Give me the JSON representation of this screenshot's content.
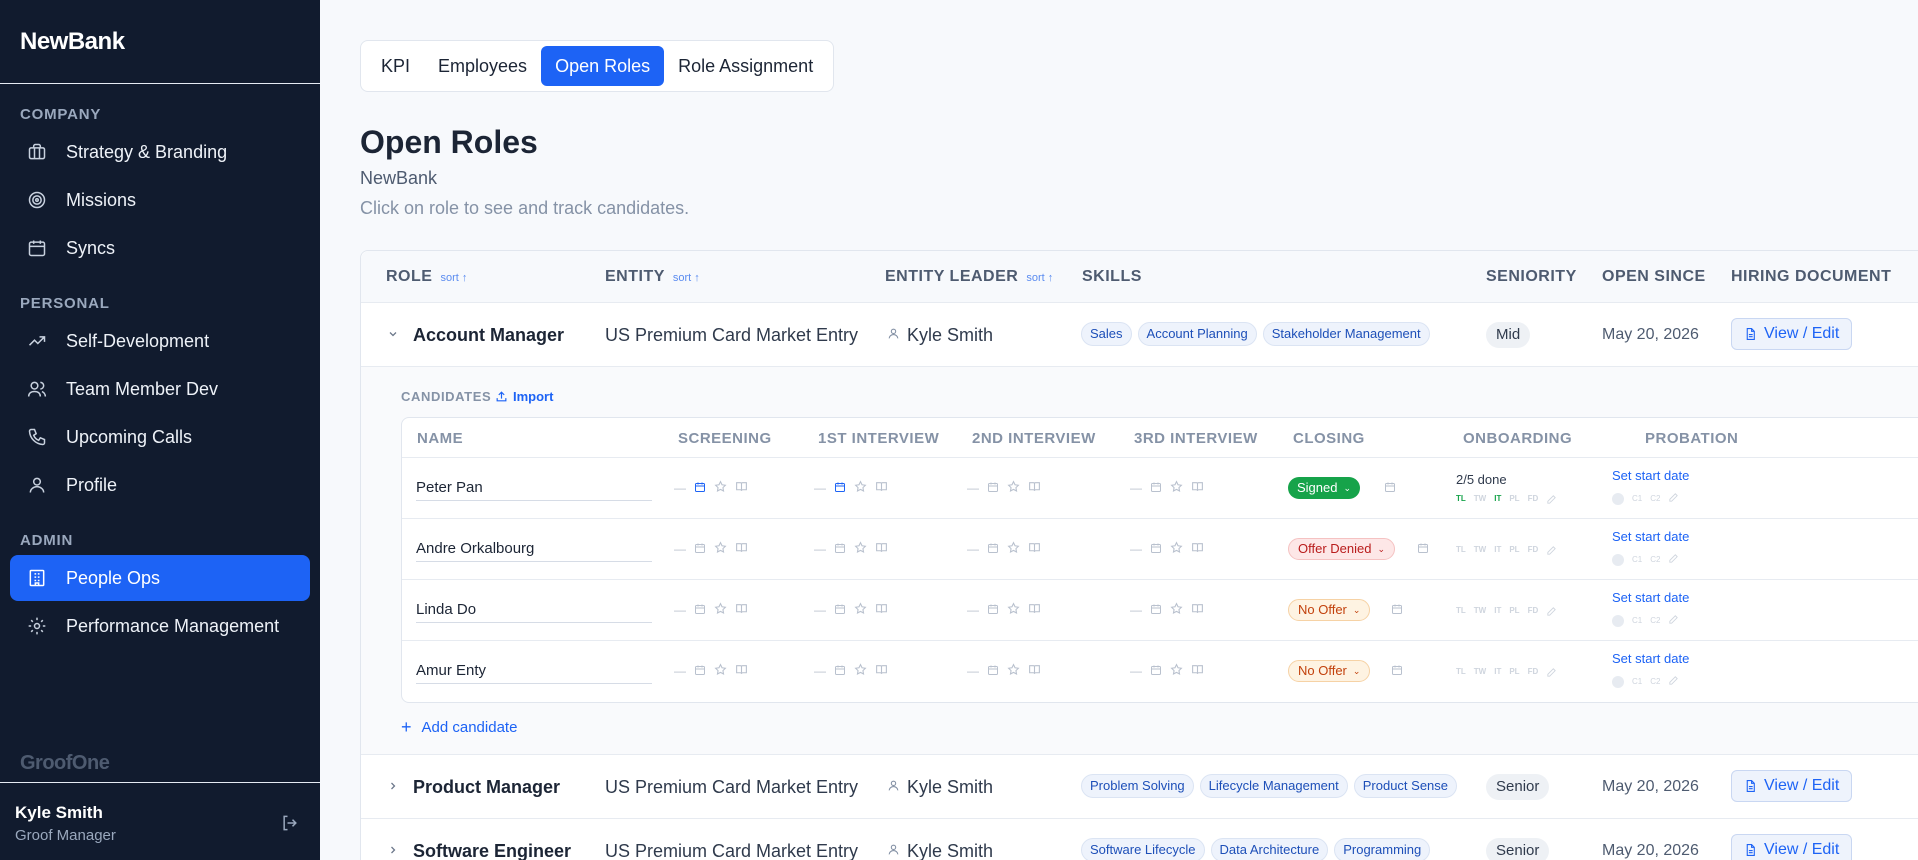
{
  "app": {
    "brand": "NewBank",
    "footer_brand": "GroofOne"
  },
  "sidebar": {
    "sections": [
      {
        "title": "COMPANY",
        "items": [
          {
            "label": "Strategy & Branding",
            "icon": "briefcase-icon"
          },
          {
            "label": "Missions",
            "icon": "target-icon"
          },
          {
            "label": "Syncs",
            "icon": "calendar-icon"
          }
        ]
      },
      {
        "title": "PERSONAL",
        "items": [
          {
            "label": "Self-Development",
            "icon": "trending-up-icon"
          },
          {
            "label": "Team Member Dev",
            "icon": "users-icon"
          },
          {
            "label": "Upcoming Calls",
            "icon": "phone-icon"
          },
          {
            "label": "Profile",
            "icon": "user-icon"
          }
        ]
      },
      {
        "title": "ADMIN",
        "items": [
          {
            "label": "People Ops",
            "icon": "building-icon",
            "active": true
          },
          {
            "label": "Performance Management",
            "icon": "gear-icon"
          }
        ]
      }
    ],
    "user": {
      "name": "Kyle Smith",
      "role": "Groof Manager"
    }
  },
  "tabs": [
    {
      "label": "KPI"
    },
    {
      "label": "Employees"
    },
    {
      "label": "Open Roles",
      "active": true
    },
    {
      "label": "Role Assignment"
    }
  ],
  "page": {
    "title": "Open Roles",
    "subtitle": "NewBank",
    "description": "Click on role to see and track candidates."
  },
  "table": {
    "headers": {
      "role": "ROLE",
      "entity": "ENTITY",
      "entity_leader": "ENTITY LEADER",
      "skills": "SKILLS",
      "seniority": "SENIORITY",
      "open_since": "OPEN SINCE",
      "hiring_document": "HIRING DOCUMENT",
      "sort_label": "sort"
    },
    "view_edit_label": "View / Edit",
    "roles": [
      {
        "name": "Account Manager",
        "entity": "US Premium Card Market Entry",
        "leader": "Kyle Smith",
        "skills": [
          "Sales",
          "Account Planning",
          "Stakeholder Management"
        ],
        "seniority": "Mid",
        "open_since": "May 20, 2026",
        "expanded": true
      },
      {
        "name": "Product Manager",
        "entity": "US Premium Card Market Entry",
        "leader": "Kyle Smith",
        "skills": [
          "Problem Solving",
          "Lifecycle Management",
          "Product Sense"
        ],
        "seniority": "Senior",
        "open_since": "May 20, 2026"
      },
      {
        "name": "Software Engineer",
        "entity": "US Premium Card Market Entry",
        "leader": "Kyle Smith",
        "skills": [
          "Software Lifecycle",
          "Data Architecture",
          "Programming"
        ],
        "seniority": "Senior",
        "open_since": "May 20, 2026"
      }
    ]
  },
  "candidates": {
    "label": "CANDIDATES",
    "import_label": "Import",
    "add_label": "Add candidate",
    "headers": {
      "name": "NAME",
      "screening": "SCREENING",
      "interview1": "1ST INTERVIEW",
      "interview2": "2ND INTERVIEW",
      "interview3": "3RD INTERVIEW",
      "closing": "CLOSING",
      "onboarding": "ONBOARDING",
      "probation": "PROBATION"
    },
    "onboarding_tags": [
      "TL",
      "TW",
      "IT",
      "PL",
      "FD"
    ],
    "probation_tags": [
      "C1",
      "C2"
    ],
    "set_start_label": "Set start date",
    "rows": [
      {
        "name": "Peter Pan",
        "status": "Signed",
        "status_type": "signed",
        "onboarding_done": "2/5 done",
        "onboarding_on": [
          0,
          2
        ]
      },
      {
        "name": "Andre Orkalbourg",
        "status": "Offer Denied",
        "status_type": "denied"
      },
      {
        "name": "Linda Do",
        "status": "No Offer",
        "status_type": "nooffer"
      },
      {
        "name": "Amur Enty",
        "status": "No Offer",
        "status_type": "nooffer"
      }
    ]
  },
  "colors": {
    "accent": "#1d63f5",
    "sidebar_bg": "#111b2e",
    "signed": "#16a34a",
    "denied": "#b91c1c",
    "nooffer": "#c2410c"
  }
}
